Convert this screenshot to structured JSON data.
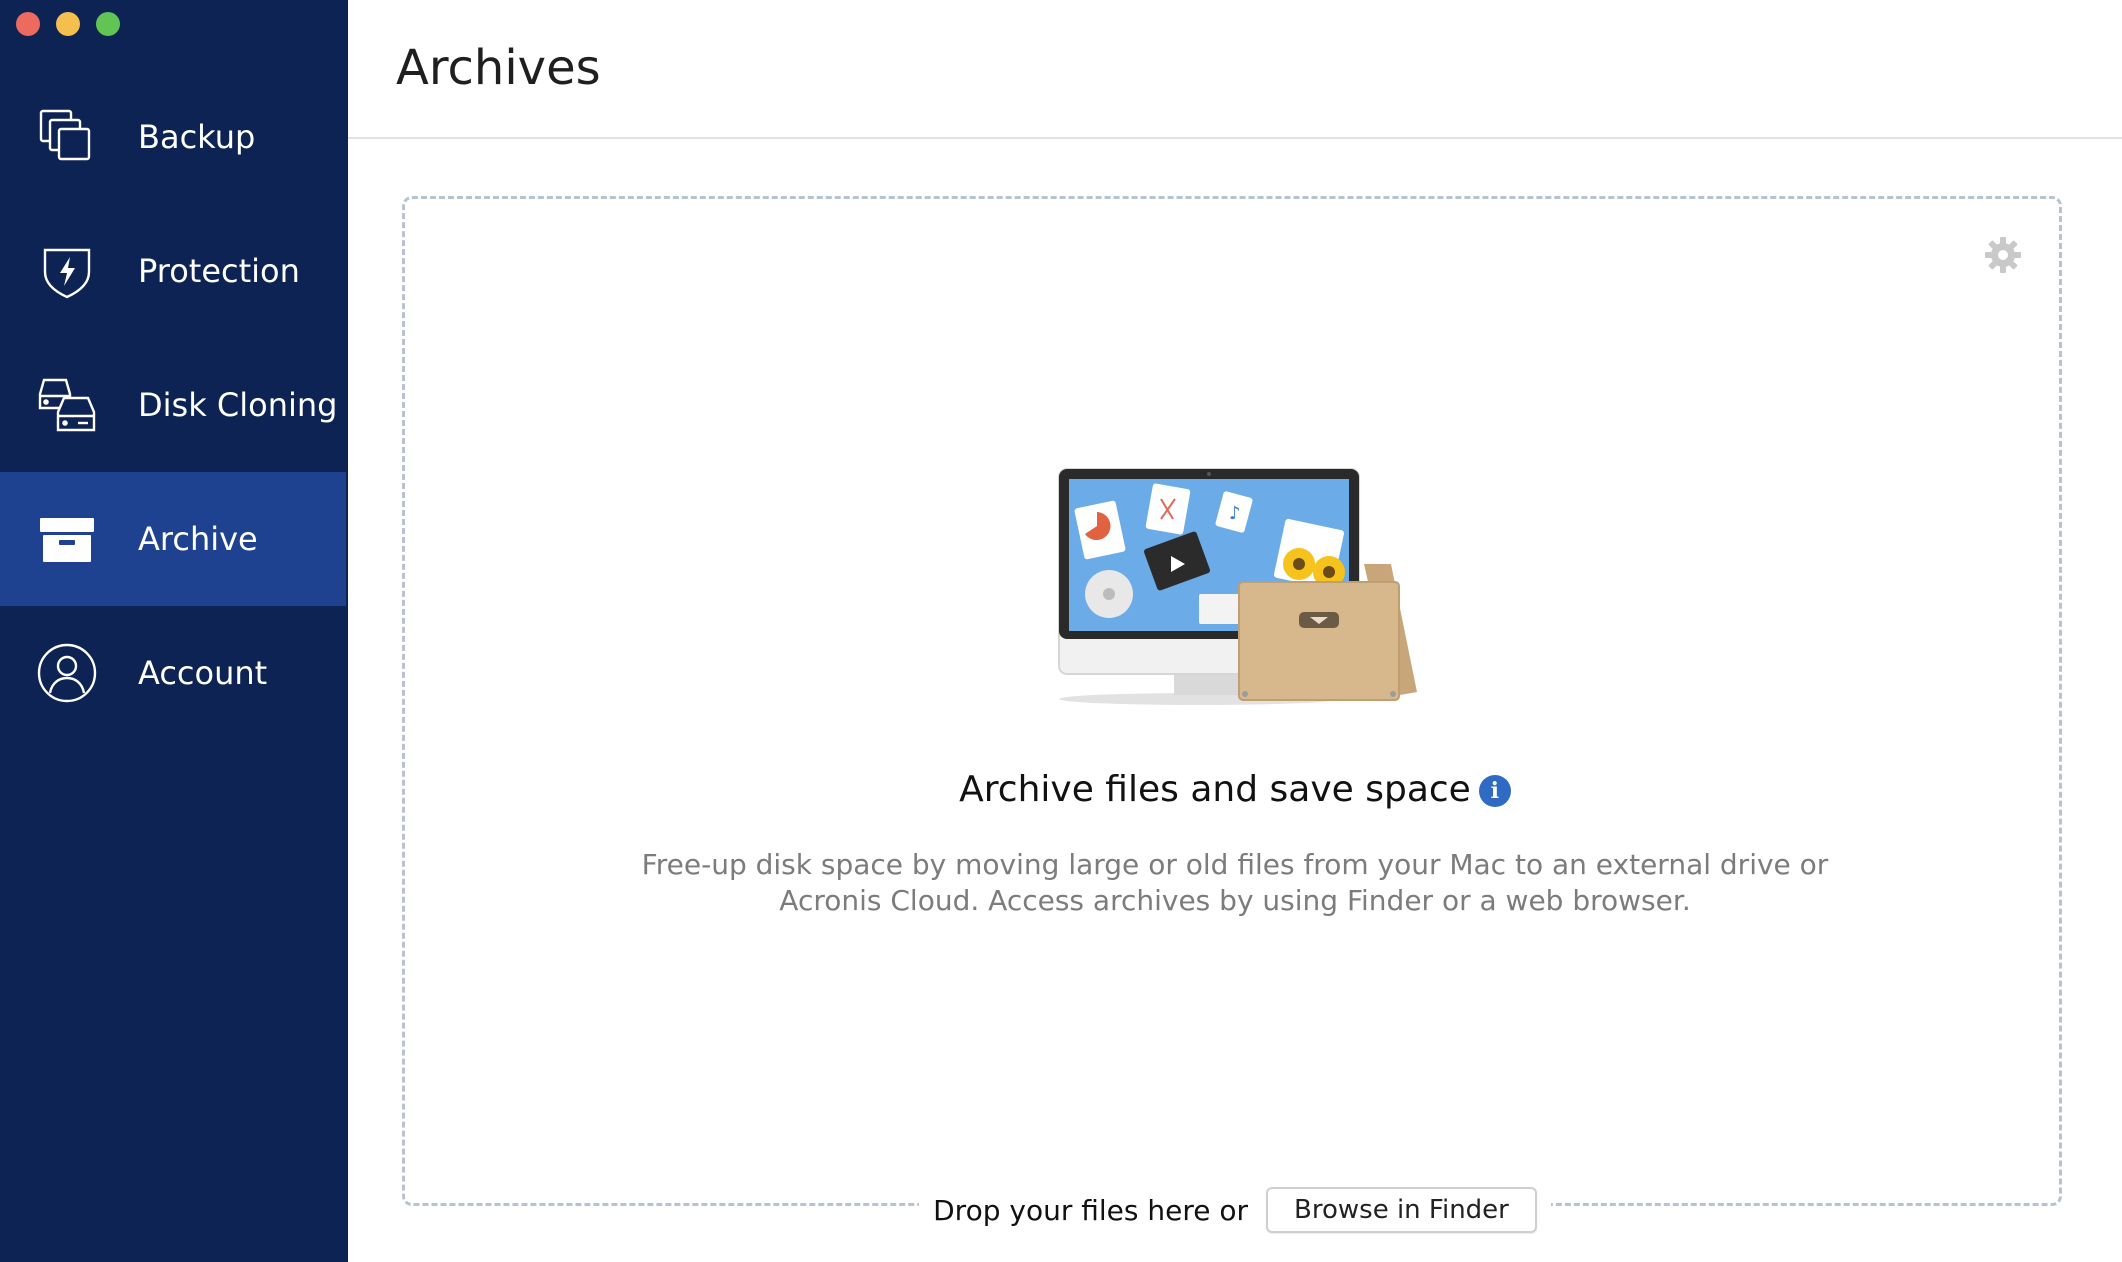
{
  "window": {
    "traffic_lights": [
      "close",
      "minimize",
      "maximize"
    ]
  },
  "sidebar": {
    "items": [
      {
        "label": "Backup",
        "icon": "backup-icon",
        "active": false
      },
      {
        "label": "Protection",
        "icon": "shield-icon",
        "active": false
      },
      {
        "label": "Disk Cloning",
        "icon": "disk-cloning-icon",
        "active": false
      },
      {
        "label": "Archive",
        "icon": "archive-box-icon",
        "active": true
      },
      {
        "label": "Account",
        "icon": "user-icon",
        "active": false
      }
    ]
  },
  "main": {
    "title": "Archives",
    "headline": "Archive files and save space",
    "info_glyph": "i",
    "description": "Free-up disk space by moving large or old files from your Mac to an external drive or Acronis Cloud. Access archives by using Finder or a web browser.",
    "drop_text": "Drop your files here or",
    "browse_button": "Browse in Finder"
  },
  "colors": {
    "sidebar_bg": "#0c2353",
    "sidebar_active": "#1e4290",
    "accent": "#2f6bc2"
  }
}
